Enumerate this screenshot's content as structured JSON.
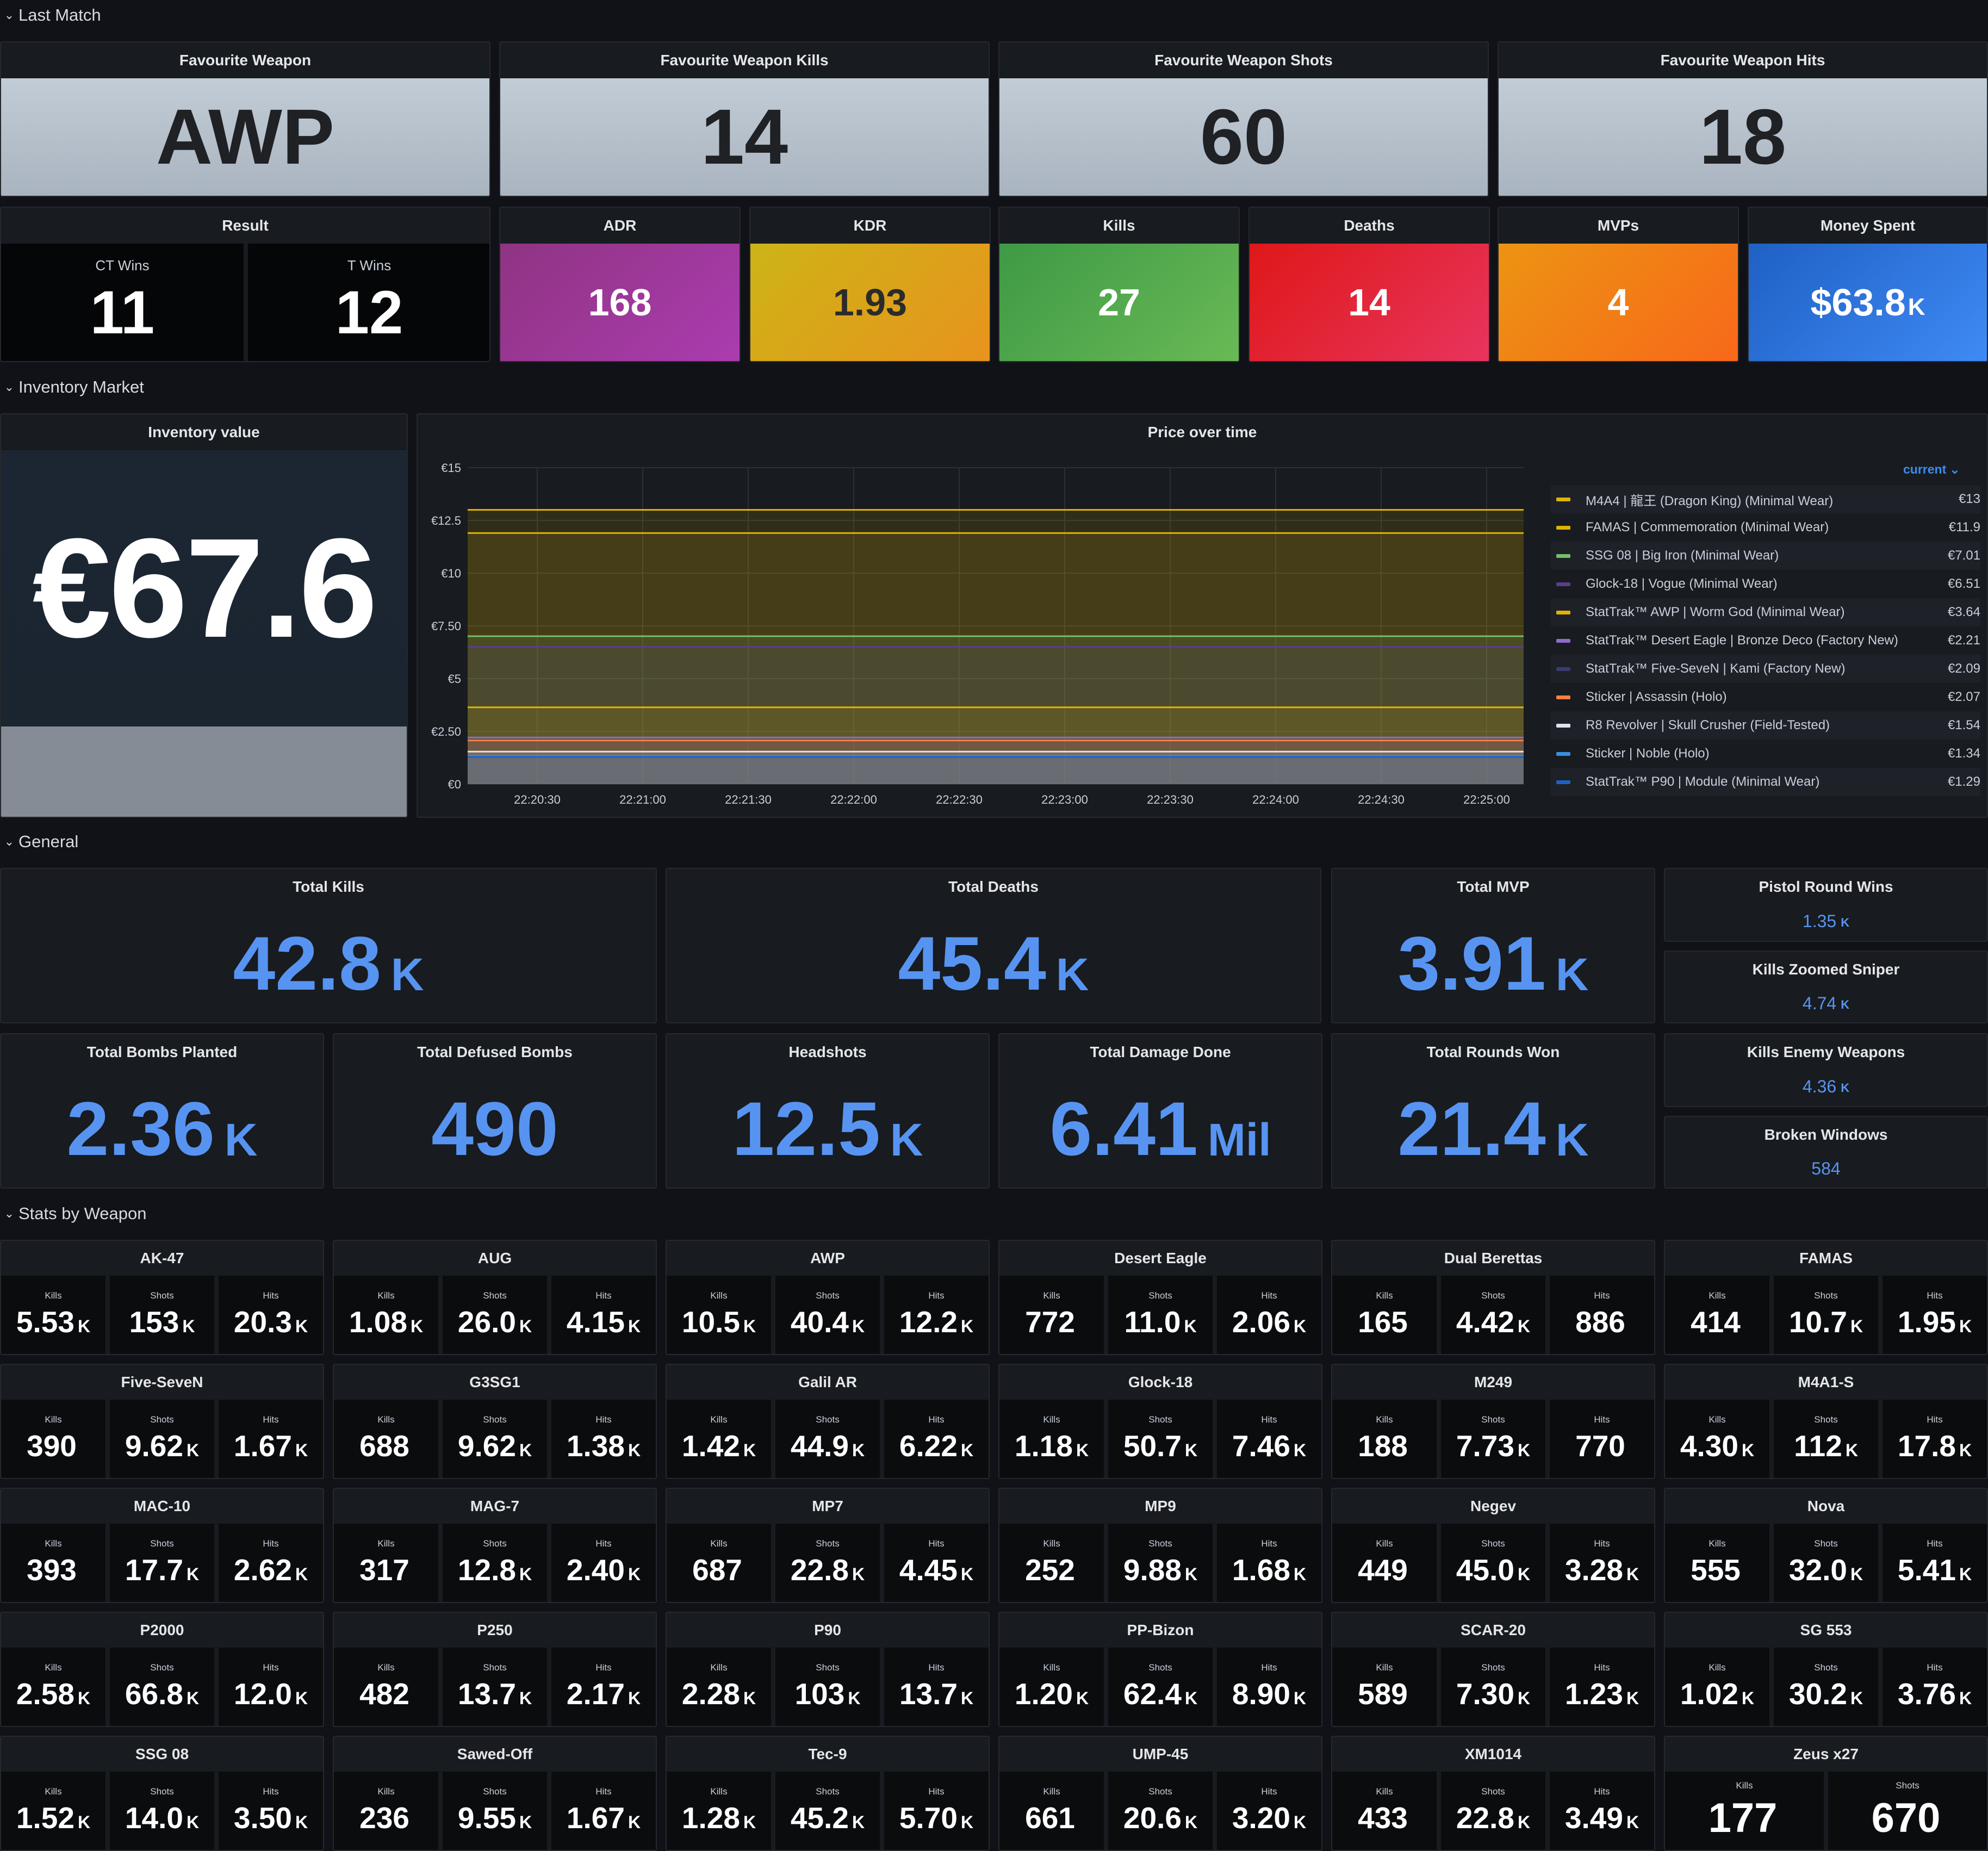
{
  "rows": {
    "last_match": "Last Match",
    "inventory": "Inventory Market",
    "general": "General",
    "weapons": "Stats by Weapon"
  },
  "last_match": {
    "fav_weapon": {
      "title": "Favourite Weapon",
      "value": "AWP"
    },
    "fav_kills": {
      "title": "Favourite Weapon Kills",
      "value": "14"
    },
    "fav_shots": {
      "title": "Favourite Weapon Shots",
      "value": "60"
    },
    "fav_hits": {
      "title": "Favourite Weapon Hits",
      "value": "18"
    },
    "result": {
      "title": "Result",
      "ct_label": "CT Wins",
      "ct_value": "11",
      "t_label": "T Wins",
      "t_value": "12"
    },
    "adr": {
      "title": "ADR",
      "value": "168",
      "color": "#a3379e"
    },
    "kdr": {
      "title": "KDR",
      "value": "1.93",
      "color": "#d6a413"
    },
    "kills": {
      "title": "Kills",
      "value": "27",
      "color": "#56a64b"
    },
    "deaths": {
      "title": "Deaths",
      "value": "14",
      "color": "#e02f44"
    },
    "mvps": {
      "title": "MVPs",
      "value": "4",
      "color": "#ff780a"
    },
    "money": {
      "title": "Money Spent",
      "value": "$63.8",
      "unit": "K",
      "color": "#1f60c4"
    }
  },
  "inventory": {
    "value_panel": {
      "title": "Inventory value",
      "value": "€67.6"
    },
    "chart_title": "Price over time",
    "legend_header": "current"
  },
  "chart_data": {
    "type": "area",
    "title": "Price over time",
    "x": [
      "22:20:30",
      "22:21:00",
      "22:21:30",
      "22:22:00",
      "22:22:30",
      "22:23:00",
      "22:23:30",
      "22:24:00",
      "22:24:30",
      "22:25:00"
    ],
    "y_ticks": [
      "€0",
      "€2.50",
      "€5",
      "€7.50",
      "€10",
      "€12.5",
      "€15"
    ],
    "ylim": [
      0,
      15
    ],
    "stacked": true,
    "grid": true,
    "legend_placement": "right",
    "series": [
      {
        "name": "M4A4 | 龍王 (Dragon King) (Minimal Wear)",
        "current": "€13",
        "value": 13.0,
        "color": "#e0b400"
      },
      {
        "name": "FAMAS | Commemoration (Minimal Wear)",
        "current": "€11.9",
        "value": 11.9,
        "color": "#e0b400"
      },
      {
        "name": "SSG 08 | Big Iron (Minimal Wear)",
        "current": "€7.01",
        "value": 7.01,
        "color": "#73bf69"
      },
      {
        "name": "Glock-18 | Vogue (Minimal Wear)",
        "current": "€6.51",
        "value": 6.51,
        "color": "#5a3e8c"
      },
      {
        "name": "StatTrak™ AWP | Worm God (Minimal Wear)",
        "current": "€3.64",
        "value": 3.64,
        "color": "#e0b400"
      },
      {
        "name": "StatTrak™ Desert Eagle | Bronze Deco (Factory New)",
        "current": "€2.21",
        "value": 2.21,
        "color": "#8f6ccc"
      },
      {
        "name": "StatTrak™ Five-SeveN | Kami (Factory New)",
        "current": "€2.09",
        "value": 2.09,
        "color": "#3b3b70"
      },
      {
        "name": "Sticker | Assassin (Holo)",
        "current": "€2.07",
        "value": 2.07,
        "color": "#ff7f43"
      },
      {
        "name": "R8 Revolver | Skull Crusher (Field-Tested)",
        "current": "€1.54",
        "value": 1.54,
        "color": "#dde4ed"
      },
      {
        "name": "Sticker | Noble (Holo)",
        "current": "€1.34",
        "value": 1.34,
        "color": "#3a8fe0"
      },
      {
        "name": "StatTrak™ P90 | Module (Minimal Wear)",
        "current": "€1.29",
        "value": 1.29,
        "color": "#1f60c4"
      }
    ]
  },
  "general": {
    "total_kills": {
      "title": "Total Kills",
      "value": "42.8",
      "unit": "K"
    },
    "total_deaths": {
      "title": "Total Deaths",
      "value": "45.4",
      "unit": "K"
    },
    "total_mvp": {
      "title": "Total MVP",
      "value": "3.91",
      "unit": "K"
    },
    "pistol_wins": {
      "title": "Pistol Round Wins",
      "value": "1.35",
      "unit": "K"
    },
    "kills_zoomed": {
      "title": "Kills Zoomed Sniper",
      "value": "4.74",
      "unit": "K"
    },
    "bombs_planted": {
      "title": "Total Bombs Planted",
      "value": "2.36",
      "unit": "K"
    },
    "defused": {
      "title": "Total Defused Bombs",
      "value": "490",
      "unit": ""
    },
    "headshots": {
      "title": "Headshots",
      "value": "12.5",
      "unit": "K"
    },
    "damage": {
      "title": "Total Damage Done",
      "value": "6.41",
      "unit": "Mil"
    },
    "rounds_won": {
      "title": "Total Rounds Won",
      "value": "21.4",
      "unit": "K"
    },
    "kills_enemy_weapons": {
      "title": "Kills Enemy Weapons",
      "value": "4.36",
      "unit": "K"
    },
    "broken_windows": {
      "title": "Broken Windows",
      "value": "584",
      "unit": ""
    }
  },
  "weapon_labels": {
    "kills": "Kills",
    "shots": "Shots",
    "hits": "Hits"
  },
  "weapons": [
    {
      "name": "AK-47",
      "kills": "5.53",
      "ku": "K",
      "shots": "153",
      "su": "K",
      "hits": "20.3",
      "hu": "K"
    },
    {
      "name": "AUG",
      "kills": "1.08",
      "ku": "K",
      "shots": "26.0",
      "su": "K",
      "hits": "4.15",
      "hu": "K"
    },
    {
      "name": "AWP",
      "kills": "10.5",
      "ku": "K",
      "shots": "40.4",
      "su": "K",
      "hits": "12.2",
      "hu": "K"
    },
    {
      "name": "Desert Eagle",
      "kills": "772",
      "ku": "",
      "shots": "11.0",
      "su": "K",
      "hits": "2.06",
      "hu": "K"
    },
    {
      "name": "Dual Berettas",
      "kills": "165",
      "ku": "",
      "shots": "4.42",
      "su": "K",
      "hits": "886",
      "hu": ""
    },
    {
      "name": "FAMAS",
      "kills": "414",
      "ku": "",
      "shots": "10.7",
      "su": "K",
      "hits": "1.95",
      "hu": "K"
    },
    {
      "name": "Five-SeveN",
      "kills": "390",
      "ku": "",
      "shots": "9.62",
      "su": "K",
      "hits": "1.67",
      "hu": "K"
    },
    {
      "name": "G3SG1",
      "kills": "688",
      "ku": "",
      "shots": "9.62",
      "su": "K",
      "hits": "1.38",
      "hu": "K"
    },
    {
      "name": "Galil AR",
      "kills": "1.42",
      "ku": "K",
      "shots": "44.9",
      "su": "K",
      "hits": "6.22",
      "hu": "K"
    },
    {
      "name": "Glock-18",
      "kills": "1.18",
      "ku": "K",
      "shots": "50.7",
      "su": "K",
      "hits": "7.46",
      "hu": "K"
    },
    {
      "name": "M249",
      "kills": "188",
      "ku": "",
      "shots": "7.73",
      "su": "K",
      "hits": "770",
      "hu": ""
    },
    {
      "name": "M4A1-S",
      "kills": "4.30",
      "ku": "K",
      "shots": "112",
      "su": "K",
      "hits": "17.8",
      "hu": "K"
    },
    {
      "name": "MAC-10",
      "kills": "393",
      "ku": "",
      "shots": "17.7",
      "su": "K",
      "hits": "2.62",
      "hu": "K"
    },
    {
      "name": "MAG-7",
      "kills": "317",
      "ku": "",
      "shots": "12.8",
      "su": "K",
      "hits": "2.40",
      "hu": "K"
    },
    {
      "name": "MP7",
      "kills": "687",
      "ku": "",
      "shots": "22.8",
      "su": "K",
      "hits": "4.45",
      "hu": "K"
    },
    {
      "name": "MP9",
      "kills": "252",
      "ku": "",
      "shots": "9.88",
      "su": "K",
      "hits": "1.68",
      "hu": "K"
    },
    {
      "name": "Negev",
      "kills": "449",
      "ku": "",
      "shots": "45.0",
      "su": "K",
      "hits": "3.28",
      "hu": "K"
    },
    {
      "name": "Nova",
      "kills": "555",
      "ku": "",
      "shots": "32.0",
      "su": "K",
      "hits": "5.41",
      "hu": "K"
    },
    {
      "name": "P2000",
      "kills": "2.58",
      "ku": "K",
      "shots": "66.8",
      "su": "K",
      "hits": "12.0",
      "hu": "K"
    },
    {
      "name": "P250",
      "kills": "482",
      "ku": "",
      "shots": "13.7",
      "su": "K",
      "hits": "2.17",
      "hu": "K"
    },
    {
      "name": "P90",
      "kills": "2.28",
      "ku": "K",
      "shots": "103",
      "su": "K",
      "hits": "13.7",
      "hu": "K"
    },
    {
      "name": "PP-Bizon",
      "kills": "1.20",
      "ku": "K",
      "shots": "62.4",
      "su": "K",
      "hits": "8.90",
      "hu": "K"
    },
    {
      "name": "SCAR-20",
      "kills": "589",
      "ku": "",
      "shots": "7.30",
      "su": "K",
      "hits": "1.23",
      "hu": "K"
    },
    {
      "name": "SG 553",
      "kills": "1.02",
      "ku": "K",
      "shots": "30.2",
      "su": "K",
      "hits": "3.76",
      "hu": "K"
    },
    {
      "name": "SSG 08",
      "kills": "1.52",
      "ku": "K",
      "shots": "14.0",
      "su": "K",
      "hits": "3.50",
      "hu": "K"
    },
    {
      "name": "Sawed-Off",
      "kills": "236",
      "ku": "",
      "shots": "9.55",
      "su": "K",
      "hits": "1.67",
      "hu": "K"
    },
    {
      "name": "Tec-9",
      "kills": "1.28",
      "ku": "K",
      "shots": "45.2",
      "su": "K",
      "hits": "5.70",
      "hu": "K"
    },
    {
      "name": "UMP-45",
      "kills": "661",
      "ku": "",
      "shots": "20.6",
      "su": "K",
      "hits": "3.20",
      "hu": "K"
    },
    {
      "name": "XM1014",
      "kills": "433",
      "ku": "",
      "shots": "22.8",
      "su": "K",
      "hits": "3.49",
      "hu": "K"
    },
    {
      "name": "Zeus x27",
      "kills": "177",
      "ku": "",
      "shots": "670",
      "su": "",
      "hits": null,
      "hu": ""
    }
  ]
}
